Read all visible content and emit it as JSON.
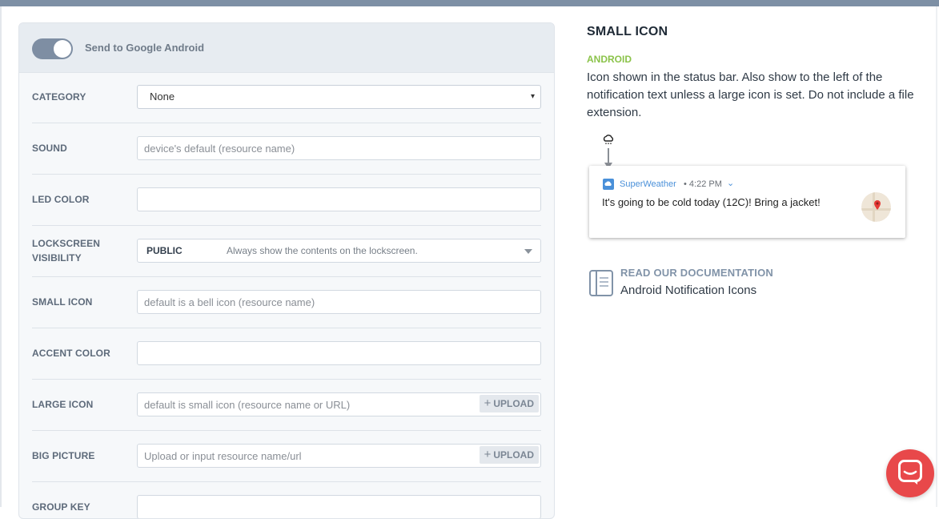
{
  "toggle": {
    "label": "Send to Google Android",
    "on": true
  },
  "form": {
    "category": {
      "label": "CATEGORY",
      "value": "None"
    },
    "sound": {
      "label": "SOUND",
      "placeholder": "device's default (resource name)",
      "value": ""
    },
    "led_color": {
      "label": "LED COLOR",
      "value": ""
    },
    "lockscreen_visibility": {
      "label_line1": "LOCKSCREEN",
      "label_line2": "VISIBILITY",
      "value": "PUBLIC",
      "description": "Always show the contents on the lockscreen."
    },
    "small_icon": {
      "label": "SMALL ICON",
      "placeholder": "default is a bell icon (resource name)",
      "value": ""
    },
    "accent_color": {
      "label": "ACCENT COLOR",
      "value": ""
    },
    "large_icon": {
      "label": "LARGE ICON",
      "placeholder": "default is small icon (resource name or URL)",
      "value": "",
      "upload_label": "UPLOAD"
    },
    "big_picture": {
      "label": "BIG PICTURE",
      "placeholder": "Upload or input resource name/url",
      "value": "",
      "upload_label": "UPLOAD"
    },
    "group_key": {
      "label": "GROUP KEY",
      "value": ""
    }
  },
  "info": {
    "title": "SMALL ICON",
    "platform": "ANDROID",
    "description": "Icon shown in the status bar. Also show to the left of the notification text unless a large icon is set. Do not include a file extension.",
    "notification": {
      "app_name": "SuperWeather",
      "time": "• 4:22 PM",
      "text": "It's going to be cold today (12C)! Bring a jacket!"
    },
    "docs": {
      "label": "READ OUR DOCUMENTATION",
      "link": "Android Notification Icons"
    }
  },
  "colors": {
    "accent_green": "#8bc34a",
    "toggle_on": "#7e8ea3",
    "chat_red": "#e8484a",
    "link_blue": "#4a90d9"
  },
  "icons": [
    "cloud-icon",
    "document-icon",
    "chat-icon",
    "chevron-down-icon",
    "plus-icon",
    "map-pin-icon"
  ]
}
